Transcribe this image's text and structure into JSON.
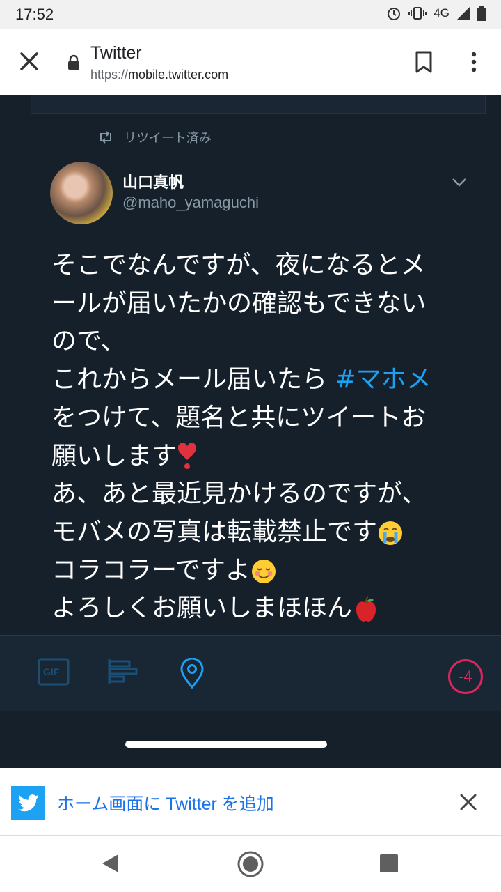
{
  "status_bar": {
    "time": "17:52",
    "network": "4G"
  },
  "browser": {
    "title": "Twitter",
    "url_scheme": "https://",
    "url_host": "mobile.twitter.com"
  },
  "tweet": {
    "retweet_label": "リツイート済み",
    "author_name": "山口真帆",
    "author_handle": "@maho_yamaguchi",
    "lines": [
      "そこでなんですが、夜になるとメ",
      "ールが届いたかの確認もできない",
      "ので、",
      "これからメール届いたら ",
      "#マホメ",
      "をつけて、題名と共にツイートお",
      "願いします",
      "あ、あと最近見かけるのですが、",
      "モバメの写真は転載禁止です",
      "コラコラーですよ",
      "よろしくお願いしまほほん"
    ],
    "emoji": [
      "heavy-heart-exclamation",
      "crying-face",
      "smiling-face",
      "red-apple"
    ]
  },
  "compose_bar": {
    "gif_label": "GIF",
    "counter": "-4",
    "counter_color": "#e0245e",
    "accent_color": "#1da1f2"
  },
  "install_banner": {
    "text": "ホーム画面に Twitter を追加"
  }
}
